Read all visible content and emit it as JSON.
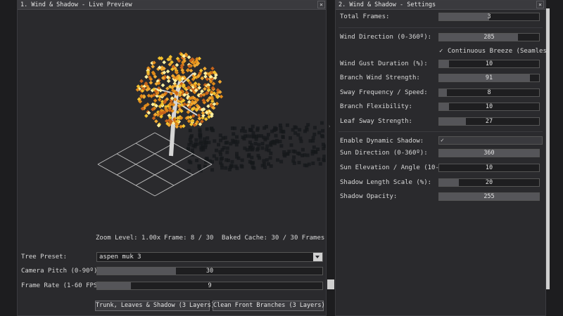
{
  "left_window": {
    "title": "1. Wind & Shadow - Live Preview",
    "status": {
      "zoom": "Zoom Level: 1.00x",
      "frame": "Frame: 8 / 30",
      "cache": "Baked Cache: 30 / 30 Frames"
    },
    "tree_preset": {
      "label": "Tree Preset:",
      "value": "aspen muk 3"
    },
    "camera_pitch": {
      "label": "Camera Pitch (0-90º):",
      "value": "30",
      "fraction": 0.35
    },
    "frame_rate": {
      "label": "Frame Rate (1-60 FPS):",
      "value": "9",
      "fraction": 0.15
    },
    "buttons": {
      "trunk": "Trunk, Leaves & Shadow (3 Layers)",
      "clean": "Clean Front Branches (3 Layers)"
    }
  },
  "right_window": {
    "title": "2. Wind & Shadow - Settings",
    "total_frames": {
      "label": "Total Frames:",
      "value": "3",
      "fraction": 0.5
    },
    "wind_direction": {
      "label": "Wind Direction (0-360º):",
      "value": "285",
      "fraction": 0.79
    },
    "continuous_breeze": {
      "label": "Continuous Breeze (Seamless L",
      "checked": true
    },
    "wind_gust_duration": {
      "label": "Wind Gust Duration (%):",
      "value": "10",
      "fraction": 0.1
    },
    "branch_wind_strength": {
      "label": "Branch Wind Strength:",
      "value": "91",
      "fraction": 0.91
    },
    "sway_frequency": {
      "label": "Sway Frequency / Speed:",
      "value": "8",
      "fraction": 0.08
    },
    "branch_flexibility": {
      "label": "Branch Flexibility:",
      "value": "10",
      "fraction": 0.1
    },
    "leaf_sway_strength": {
      "label": "Leaf Sway Strength:",
      "value": "27",
      "fraction": 0.27
    },
    "enable_dynamic_shadow": {
      "label": "Enable Dynamic Shadow:",
      "checked": true
    },
    "sun_direction": {
      "label": "Sun Direction (0-360º):",
      "value": "360",
      "fraction": 1.0
    },
    "sun_elevation": {
      "label": "Sun Elevation / Angle (10-85º):",
      "value": "10",
      "fraction": 0.0
    },
    "shadow_length": {
      "label": "Shadow Length Scale (%):",
      "value": "20",
      "fraction": 0.2
    },
    "shadow_opacity": {
      "label": "Shadow Opacity:",
      "value": "255",
      "fraction": 1.0
    }
  },
  "icons": {
    "close": "close-icon",
    "dropdown": "chevron-down-icon",
    "check": "checkmark-icon"
  },
  "colors": {
    "leaf_orange": "#e08a1a",
    "leaf_yellow": "#f2c12e",
    "trunk": "#d6d6d6",
    "shadow": "#16181b"
  }
}
